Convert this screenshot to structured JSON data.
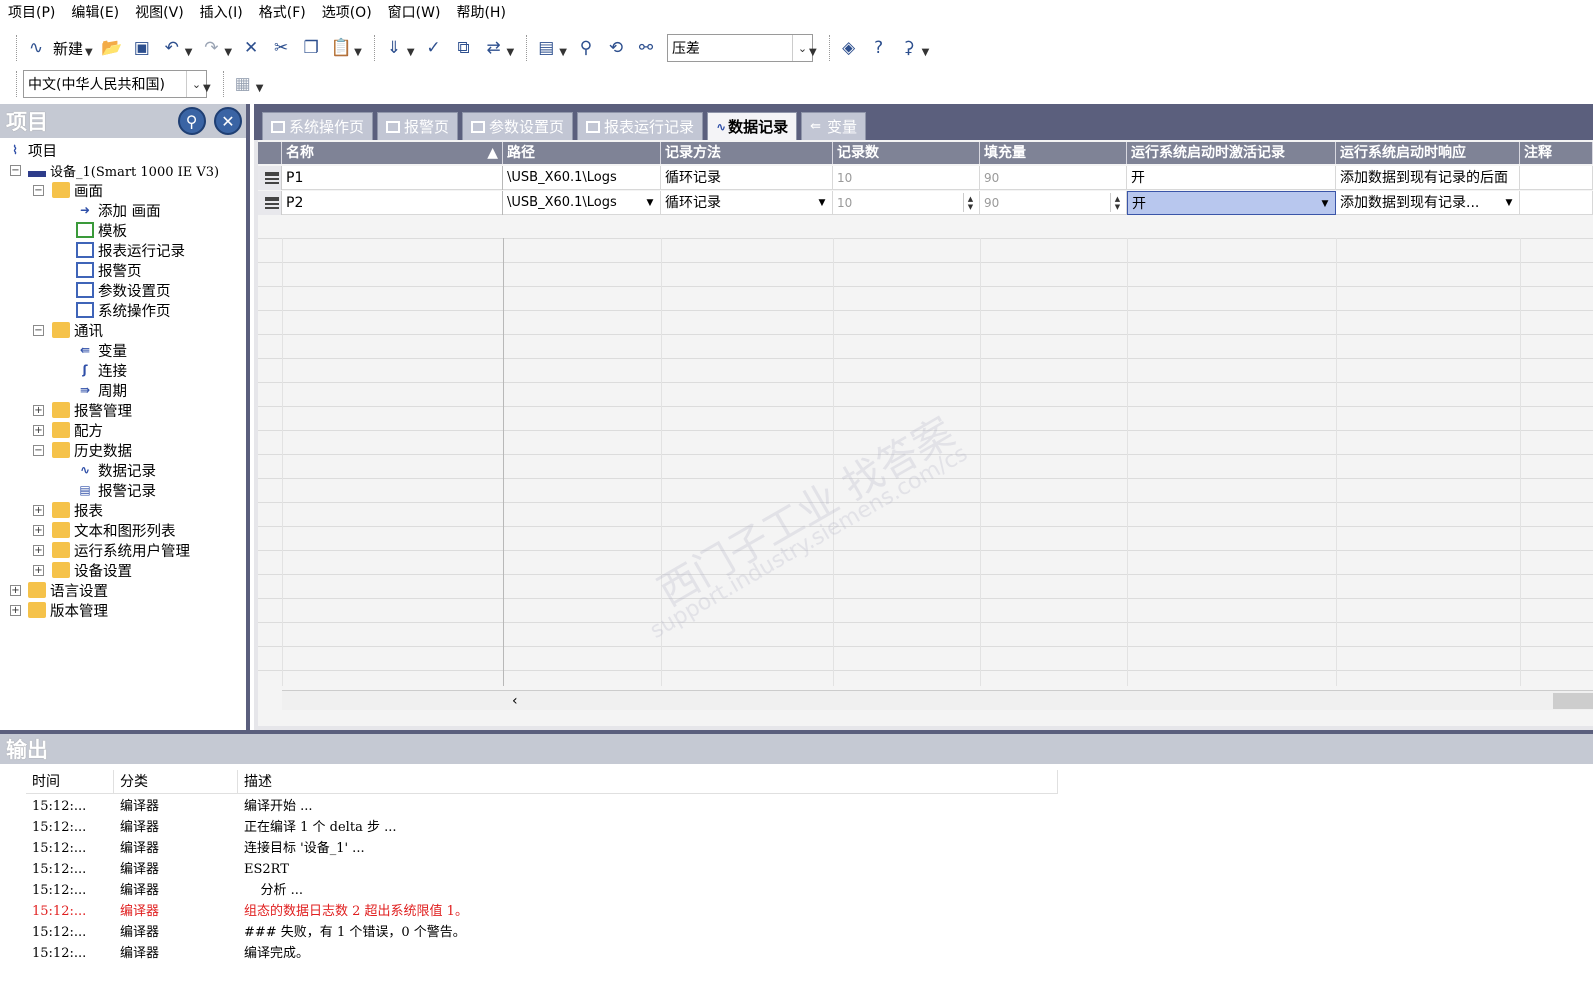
{
  "menubar": [
    "项目(P)",
    "编辑(E)",
    "视图(V)",
    "插入(I)",
    "格式(F)",
    "选项(O)",
    "窗口(W)",
    "帮助(H)"
  ],
  "toolbar": {
    "new_label": "新建",
    "combo_value": "压差",
    "language_value": "中文(中华人民共和国)"
  },
  "project": {
    "title": "项目",
    "tree": [
      {
        "label": "项目",
        "level": 0
      },
      {
        "label": "设备_1(Smart 1000 IE V3)",
        "level": 1
      },
      {
        "label": "画面",
        "level": 2
      },
      {
        "label": "添加 画面",
        "level": 3
      },
      {
        "label": "模板",
        "level": 3
      },
      {
        "label": "报表运行记录",
        "level": 3
      },
      {
        "label": "报警页",
        "level": 3
      },
      {
        "label": "参数设置页",
        "level": 3
      },
      {
        "label": "系统操作页",
        "level": 3
      },
      {
        "label": "通讯",
        "level": 2
      },
      {
        "label": "变量",
        "level": 3
      },
      {
        "label": "连接",
        "level": 3
      },
      {
        "label": "周期",
        "level": 3
      },
      {
        "label": "报警管理",
        "level": 2
      },
      {
        "label": "配方",
        "level": 2
      },
      {
        "label": "历史数据",
        "level": 2
      },
      {
        "label": "数据记录",
        "level": 3
      },
      {
        "label": "报警记录",
        "level": 3
      },
      {
        "label": "报表",
        "level": 2
      },
      {
        "label": "文本和图形列表",
        "level": 2
      },
      {
        "label": "运行系统用户管理",
        "level": 2
      },
      {
        "label": "设备设置",
        "level": 2
      },
      {
        "label": "语言设置",
        "level": 1
      },
      {
        "label": "版本管理",
        "level": 1
      }
    ]
  },
  "tabs": [
    "系统操作页",
    "报警页",
    "参数设置页",
    "报表运行记录",
    "数据记录",
    "变量"
  ],
  "active_tab": "数据记录",
  "table": {
    "columns": [
      "名称",
      "路径",
      "记录方法",
      "记录数",
      "填充量",
      "运行系统启动时激活记录",
      "运行系统启动时响应",
      "注释"
    ],
    "rows": [
      [
        "P1",
        "\\USB_X60.1\\Logs",
        "循环记录",
        "10",
        "90",
        "开",
        "添加数据到现有记录的后面",
        ""
      ],
      [
        "P2",
        "\\USB_X60.1\\Logs",
        "循环记录",
        "10",
        "90",
        "开",
        "添加数据到现有记录...",
        ""
      ]
    ]
  },
  "watermark": {
    "line1": "西门子工业  找答案",
    "line2": "support.industry.siemens.com/cs"
  },
  "output": {
    "title": "输出",
    "columns": [
      "时间",
      "分类",
      "描述"
    ],
    "rows": [
      {
        "time": "15:12:...",
        "cat": "编译器",
        "desc": "编译开始 ...",
        "error": false
      },
      {
        "time": "15:12:...",
        "cat": "编译器",
        "desc": "正在编译 1 个 delta 步 ...",
        "error": false
      },
      {
        "time": "15:12:...",
        "cat": "编译器",
        "desc": "连接目标 '设备_1' ...",
        "error": false
      },
      {
        "time": "15:12:...",
        "cat": "编译器",
        "desc": "ES2RT",
        "error": false
      },
      {
        "time": "15:12:...",
        "cat": "编译器",
        "desc": "    分析 ...",
        "error": false
      },
      {
        "time": "15:12:...",
        "cat": "编译器",
        "desc": "组态的数据日志数 2 超出系统限值 1。",
        "error": true
      },
      {
        "time": "15:12:...",
        "cat": "编译器",
        "desc": "### 失败，有 1 个错误，0 个警告。",
        "error": false
      },
      {
        "time": "15:12:...",
        "cat": "编译器",
        "desc": "编译完成。",
        "error": false
      }
    ]
  }
}
